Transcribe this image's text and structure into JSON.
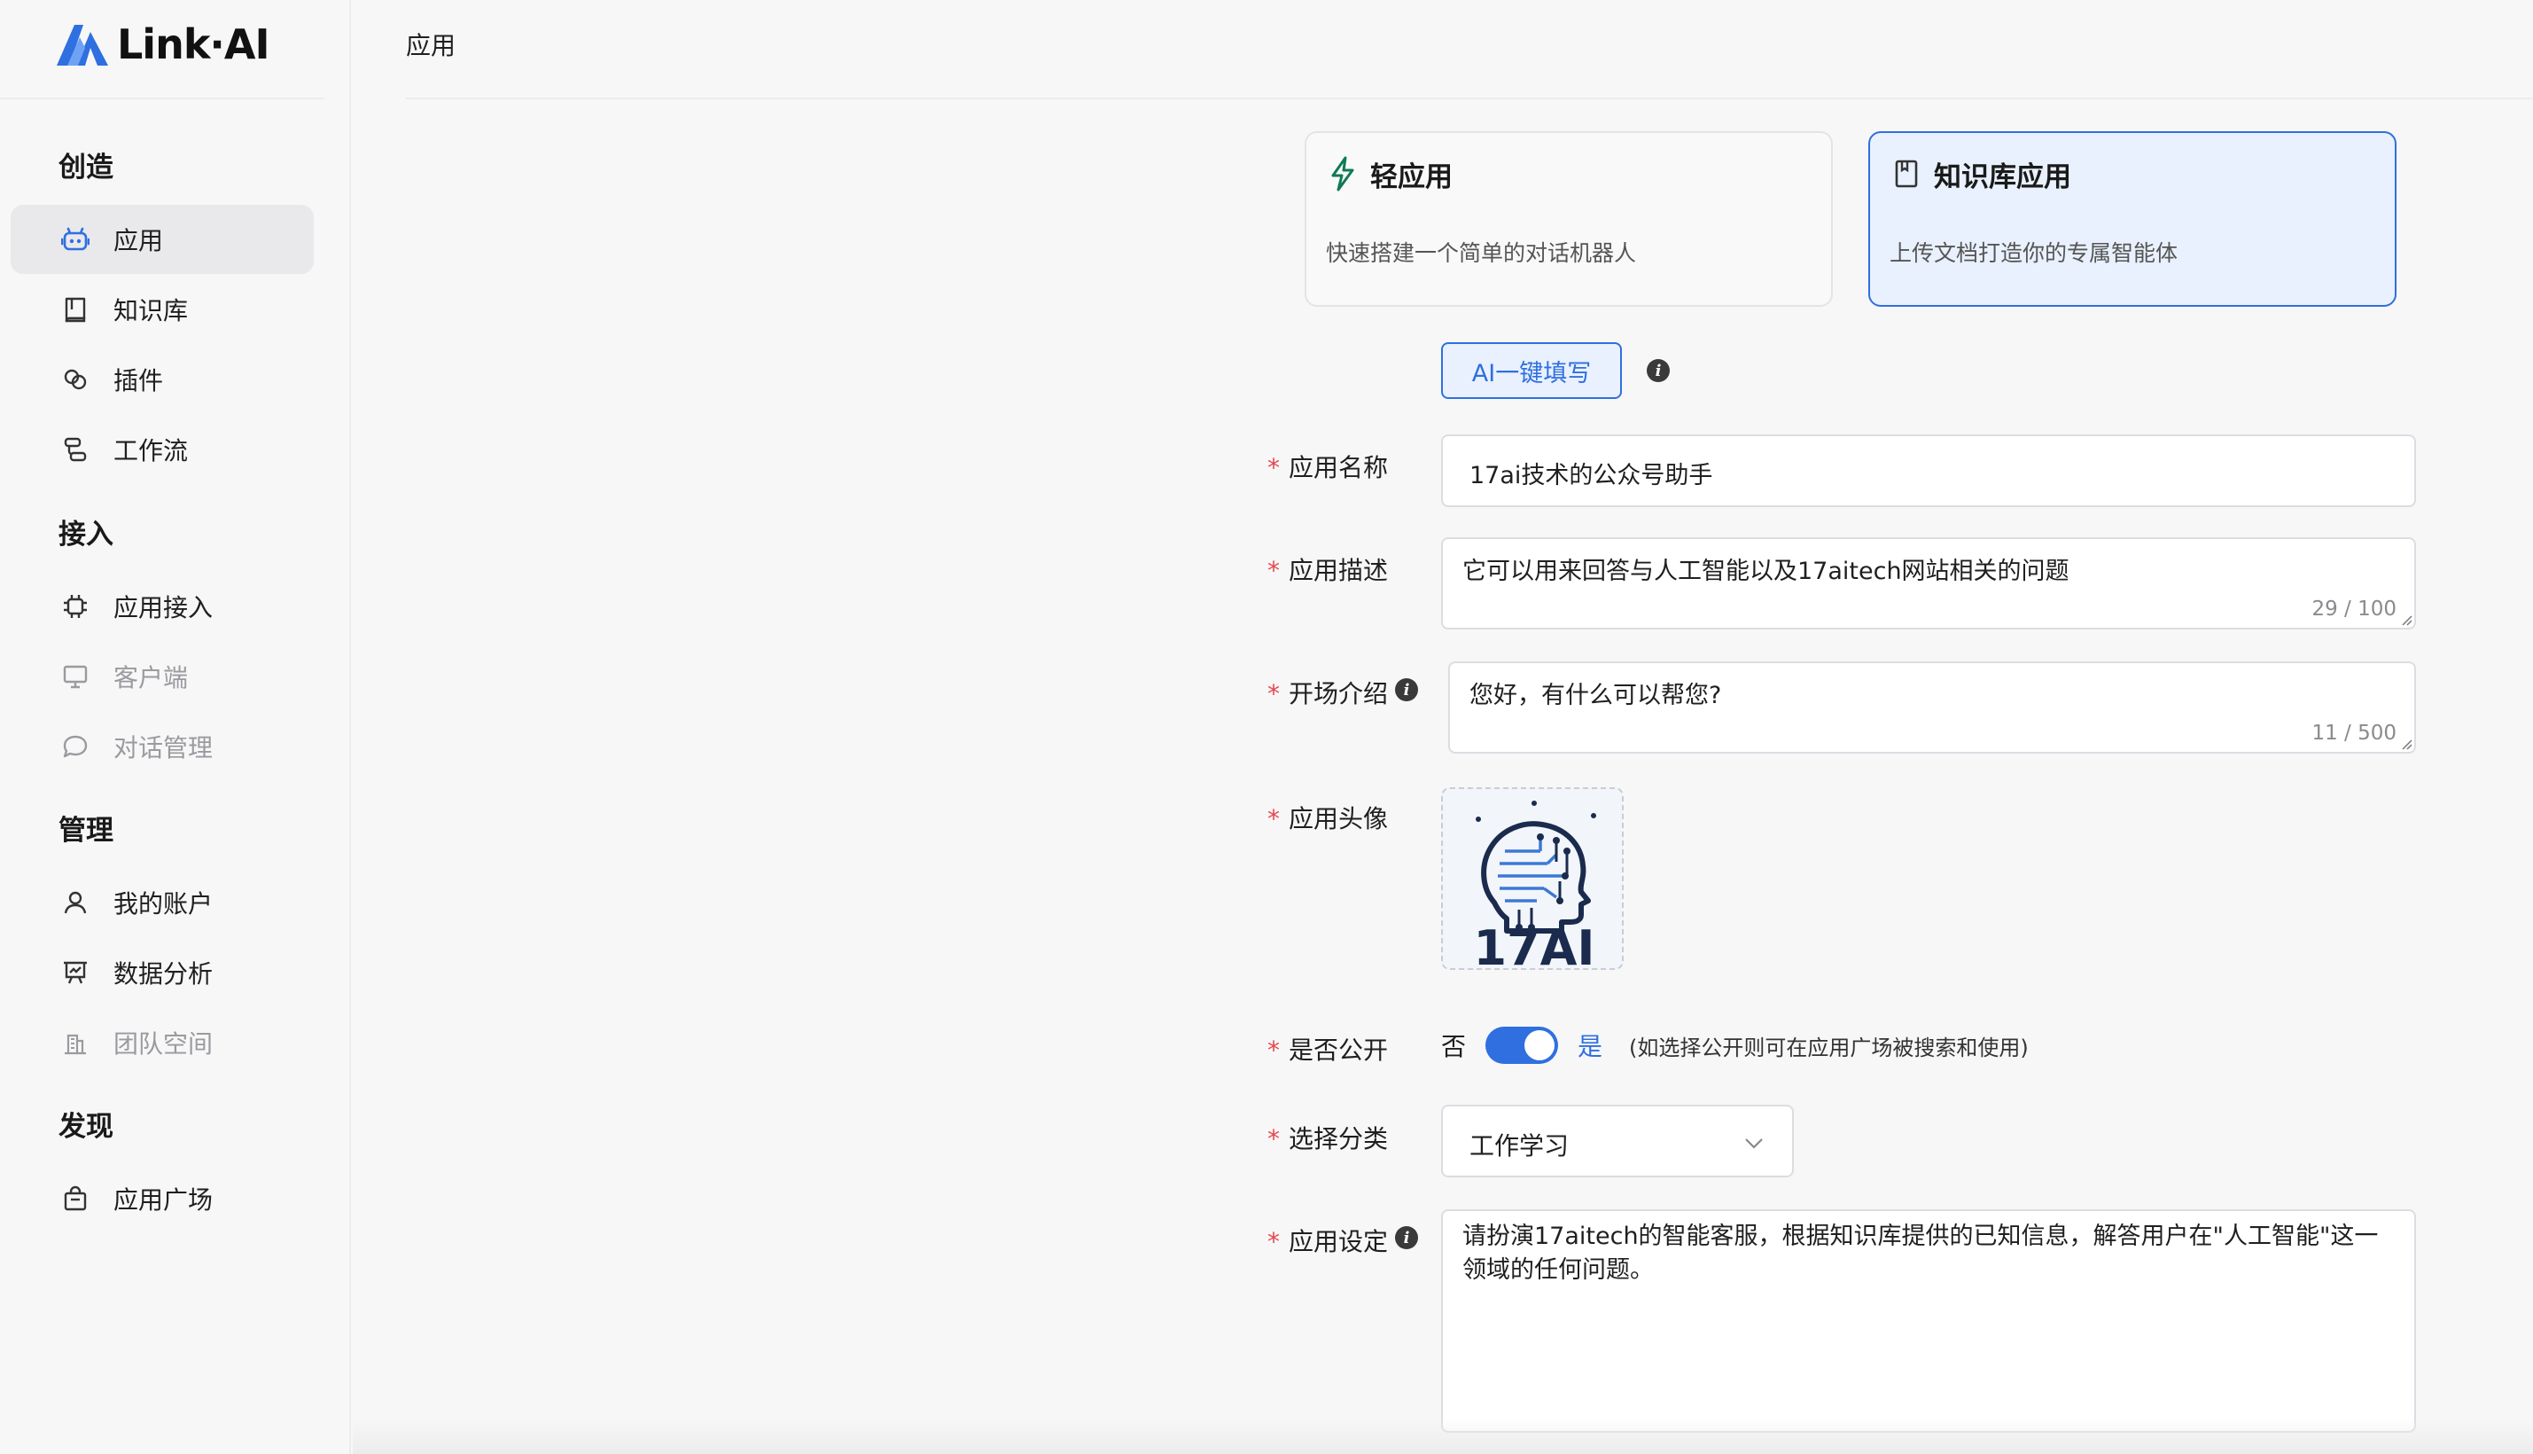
{
  "app": {
    "brand": "Link·AI",
    "accent": "#2f6fe0"
  },
  "sidebar": {
    "sections": [
      {
        "title": "创造"
      },
      {
        "title": "接入"
      },
      {
        "title": "管理"
      },
      {
        "title": "发现"
      }
    ],
    "items": [
      {
        "label": "应用",
        "icon": "robot-icon",
        "active": true
      },
      {
        "label": "知识库",
        "icon": "book-icon"
      },
      {
        "label": "插件",
        "icon": "plugin-icon"
      },
      {
        "label": "工作流",
        "icon": "workflow-icon"
      },
      {
        "label": "应用接入",
        "icon": "chip-icon"
      },
      {
        "label": "客户端",
        "icon": "monitor-icon",
        "disabled": true
      },
      {
        "label": "对话管理",
        "icon": "chat-bubble-icon",
        "disabled": true
      },
      {
        "label": "我的账户",
        "icon": "user-icon"
      },
      {
        "label": "数据分析",
        "icon": "presentation-chart-icon"
      },
      {
        "label": "团队空间",
        "icon": "building-icon",
        "disabled": true
      },
      {
        "label": "应用广场",
        "icon": "shopping-bag-icon"
      }
    ]
  },
  "header": {
    "title": "应用"
  },
  "app_types": [
    {
      "title": "轻应用",
      "desc": "快速搭建一个简单的对话机器人",
      "icon": "lightning-icon",
      "selected": false
    },
    {
      "title": "知识库应用",
      "desc": "上传文档打造你的专属智能体",
      "icon": "document-icon",
      "selected": true
    }
  ],
  "ai_fill_button": "AI一键填写",
  "form": {
    "name": {
      "label": "应用名称",
      "value": "17ai技术的公众号助手"
    },
    "description": {
      "label": "应用描述",
      "value": "它可以用来回答与人工智能以及17aitech网站相关的问题",
      "count": "29 / 100"
    },
    "intro": {
      "label": "开场介绍",
      "value": "您好，有什么可以帮您?",
      "count": "11 / 500"
    },
    "avatar": {
      "label": "应用头像",
      "text": "17AI"
    },
    "public": {
      "label": "是否公开",
      "off_label": "否",
      "on_label": "是",
      "enabled": true,
      "hint": "(如选择公开则可在应用广场被搜索和使用)"
    },
    "category": {
      "label": "选择分类",
      "value": "工作学习"
    },
    "prompt": {
      "label": "应用设定",
      "value": "请扮演17aitech的智能客服，根据知识库提供的已知信息，解答用户在\"人工智能\"这一领域的任何问题。"
    }
  }
}
